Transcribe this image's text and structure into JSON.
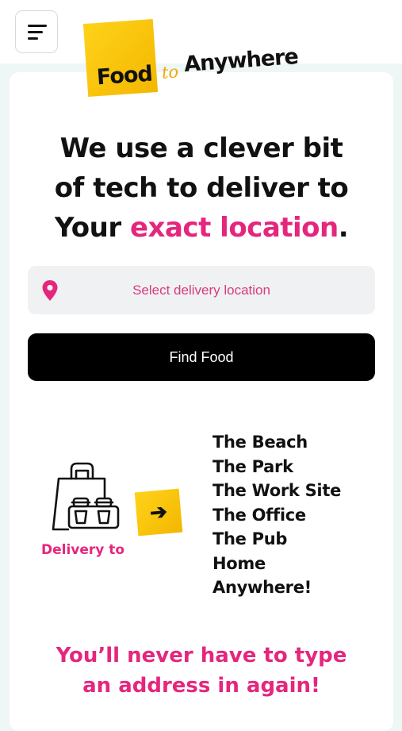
{
  "header": {
    "menu_icon": "hamburger-menu-icon",
    "logo": {
      "word1": "Food",
      "word2": "to",
      "word3": "Anywhere"
    }
  },
  "hero": {
    "line1": "We use a clever bit",
    "line2": "of tech to deliver to",
    "line3_start": "Your ",
    "line3_highlight": "exact location",
    "line3_end": "."
  },
  "location_field": {
    "icon": "map-pin-icon",
    "placeholder": "Select delivery location"
  },
  "find_button": {
    "label": "Find Food"
  },
  "delivery": {
    "label": "Delivery to",
    "bag_icon": "takeaway-bag-icon",
    "arrow_icon": "arrow-right-icon",
    "places": [
      "The Beach",
      "The Park",
      "The Work Site",
      "The Office",
      "The Pub",
      "Home",
      "Anywhere!"
    ]
  },
  "tagline": {
    "line1": "You’ll never have to type",
    "line2": "an address in again!"
  },
  "colors": {
    "accent_pink": "#e5267d",
    "accent_yellow": "#f7c20b",
    "button_black": "#000000"
  }
}
